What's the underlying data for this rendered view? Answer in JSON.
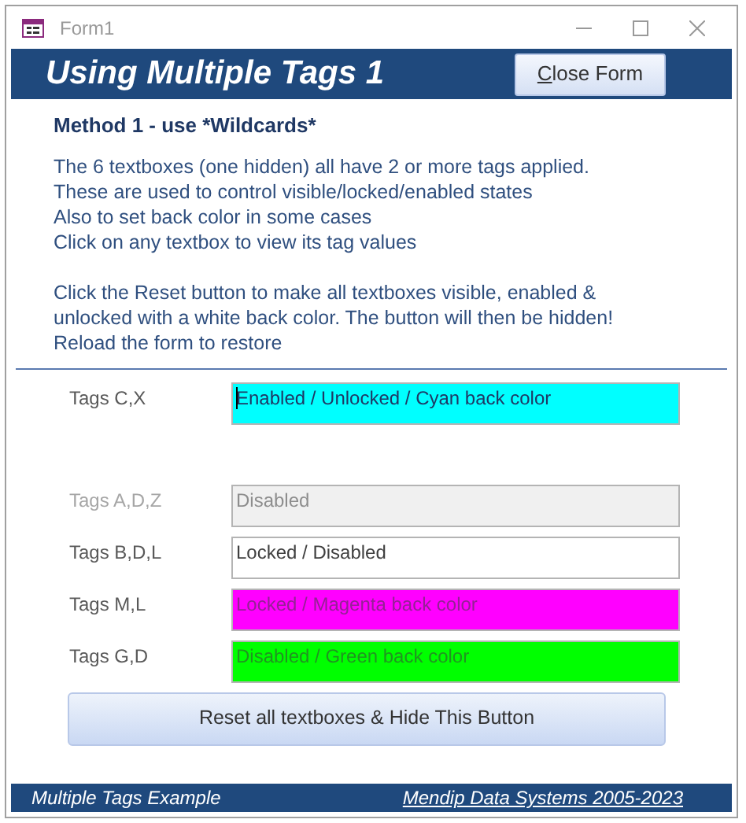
{
  "window": {
    "title": "Form1"
  },
  "header": {
    "title": "Using Multiple Tags 1",
    "close_button": "Close Form"
  },
  "method_heading": "Method 1 - use *Wildcards*",
  "paragraphs": [
    [
      "The 6 textboxes (one hidden) all have 2 or more tags applied.",
      "These are used to control visible/locked/enabled states",
      "Also to set back color in some cases",
      "Click on any textbox to view its tag values"
    ],
    [
      "Click the Reset button to make all textboxes visible, enabled &",
      "unlocked with a white back color. The button will then be hidden!",
      "Reload the form to restore"
    ]
  ],
  "rows": [
    {
      "label": "Tags C,X",
      "label_disabled": false,
      "value": "Enabled / Unlocked / Cyan back color",
      "color": "#00ffff",
      "text_disabled": false,
      "focused": true
    },
    {
      "label": "Tags A,D,Z",
      "label_disabled": true,
      "value": "Disabled",
      "color": "#f0f0f0",
      "text_disabled": true,
      "focused": false
    },
    {
      "label": "Tags B,D,L",
      "label_disabled": false,
      "value": "Locked / Disabled",
      "color": "#ffffff",
      "text_disabled": false,
      "focused": false
    },
    {
      "label": "Tags M,L",
      "label_disabled": false,
      "value": "Locked / Magenta back color",
      "color": "#ff00ff",
      "text_disabled": true,
      "focused": false
    },
    {
      "label": "Tags G,D",
      "label_disabled": false,
      "value": "Disabled / Green back color",
      "color": "#00ff00",
      "text_disabled": true,
      "focused": false
    }
  ],
  "reset_button": "Reset all textboxes & Hide This Button",
  "footer": {
    "left": "Multiple Tags Example",
    "right": "Mendip Data Systems 2005-2023"
  }
}
